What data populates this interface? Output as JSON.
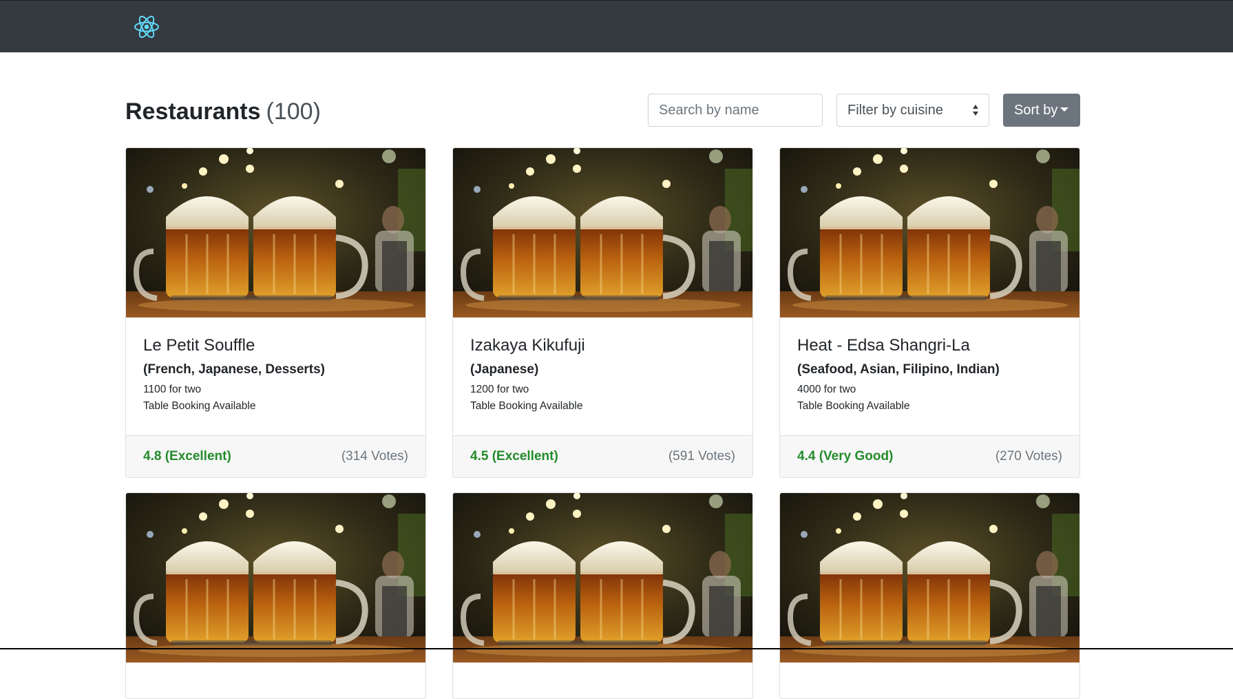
{
  "navbar": {
    "logo_icon": "react-atom-icon",
    "bg_color": "#343a40",
    "logo_color": "#61dafb"
  },
  "header": {
    "title": "Restaurants",
    "count": "(100)"
  },
  "controls": {
    "search_placeholder": "Search by name",
    "filter_label": "Filter by cuisine",
    "sort_label": "Sort by"
  },
  "colors": {
    "rating": "#238b2b",
    "sort_button": "#6c757d"
  },
  "restaurants": [
    {
      "name": "Le Petit Souffle",
      "cuisines": "(French, Japanese, Desserts)",
      "cost": "1100 for two",
      "booking": "Table Booking Available",
      "rating": "4.8 (Excellent)",
      "votes": "(314 Votes)"
    },
    {
      "name": "Izakaya Kikufuji",
      "cuisines": "(Japanese)",
      "cost": "1200 for two",
      "booking": "Table Booking Available",
      "rating": "4.5 (Excellent)",
      "votes": "(591 Votes)"
    },
    {
      "name": "Heat - Edsa Shangri-La",
      "cuisines": "(Seafood, Asian, Filipino, Indian)",
      "cost": "4000 for two",
      "booking": "Table Booking Available",
      "rating": "4.4 (Very Good)",
      "votes": "(270 Votes)"
    }
  ]
}
